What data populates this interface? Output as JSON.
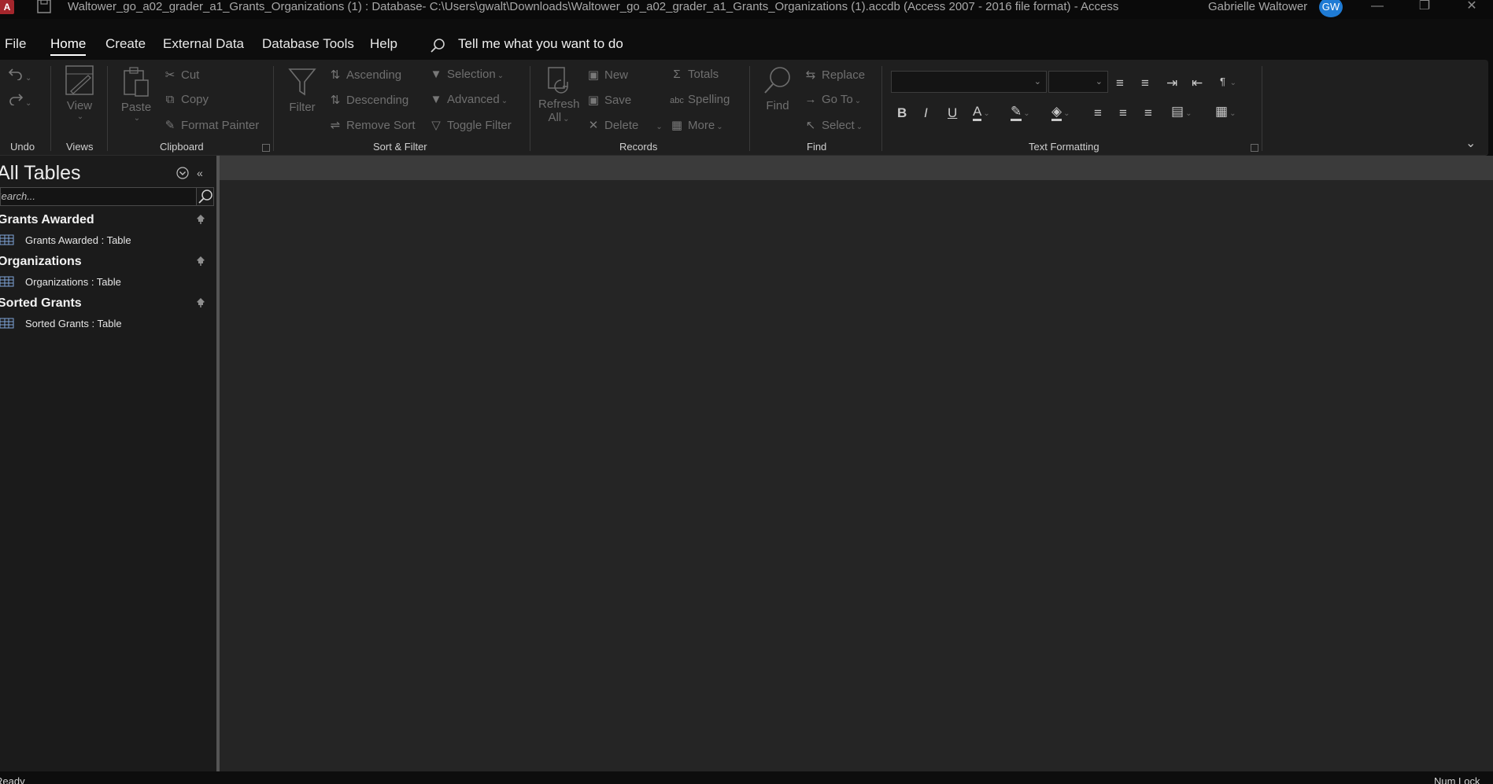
{
  "titlebar": {
    "app_icon_letter": "A",
    "title": "Waltower_go_a02_grader_a1_Grants_Organizations (1) : Database- C:\\Users\\gwalt\\Downloads\\Waltower_go_a02_grader_a1_Grants_Organizations (1).accdb (Access 2007 - 2016 file format)  -  Access",
    "user_name": "Gabrielle Waltower",
    "user_initials": "GW",
    "avatar_color": "#1f7bd4"
  },
  "menu": {
    "tabs": [
      "File",
      "Home",
      "Create",
      "External Data",
      "Database Tools",
      "Help"
    ],
    "active_tab": "Home",
    "tell_me": "Tell me what you want to do"
  },
  "ribbon": {
    "undo_group": "Undo",
    "views_group": "Views",
    "view_btn": "View",
    "clipboard_group": "Clipboard",
    "paste_btn": "Paste",
    "cut_btn": "Cut",
    "copy_btn": "Copy",
    "format_painter_btn": "Format Painter",
    "sort_filter_group": "Sort & Filter",
    "filter_btn": "Filter",
    "ascending_btn": "Ascending",
    "descending_btn": "Descending",
    "remove_sort_btn": "Remove Sort",
    "selection_btn": "Selection",
    "advanced_btn": "Advanced",
    "toggle_filter_btn": "Toggle Filter",
    "records_group": "Records",
    "refresh_btn_1": "Refresh",
    "refresh_btn_2": "All",
    "new_btn": "New",
    "save_btn": "Save",
    "delete_btn": "Delete",
    "totals_btn": "Totals",
    "spelling_btn": "Spelling",
    "more_btn": "More",
    "find_group": "Find",
    "find_btn": "Find",
    "replace_btn": "Replace",
    "goto_btn": "Go To",
    "select_btn": "Select",
    "text_formatting_group": "Text Formatting",
    "bold": "B",
    "italic": "I",
    "underline": "U",
    "font_name": "",
    "font_size": ""
  },
  "nav": {
    "header": "All Tables",
    "search_placeholder": "Search...",
    "groups": [
      {
        "name": "Grants Awarded",
        "item": "Grants Awarded : Table"
      },
      {
        "name": "Organizations",
        "item": "Organizations : Table"
      },
      {
        "name": "Sorted Grants",
        "item": "Sorted Grants : Table"
      }
    ]
  },
  "status": {
    "left": "Ready",
    "right": "Num Lock"
  }
}
